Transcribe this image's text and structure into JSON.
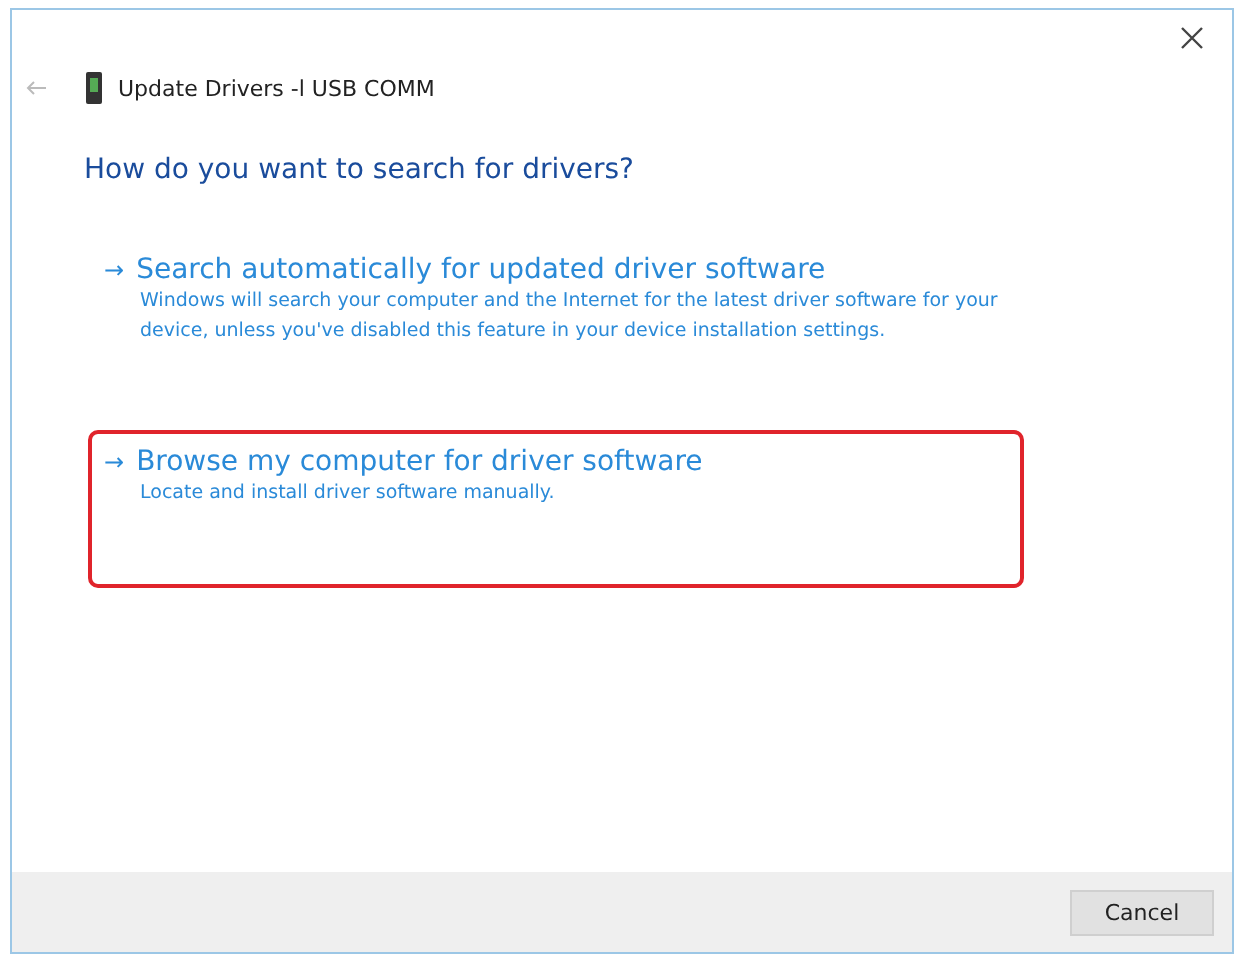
{
  "window": {
    "title": "Update Drivers -l USB COMM"
  },
  "heading": "How do you want to search for drivers?",
  "options": [
    {
      "arrow": "→",
      "label": "Search automatically for updated driver software",
      "description": "Windows will search your computer and the Internet for the latest driver software for your device, unless you've disabled this feature in your device installation settings.",
      "highlighted": false
    },
    {
      "arrow": "→",
      "label": "Browse my computer for driver software",
      "description": "Locate and install driver software manually.",
      "highlighted": true
    }
  ],
  "buttons": [
    "Cancel"
  ]
}
